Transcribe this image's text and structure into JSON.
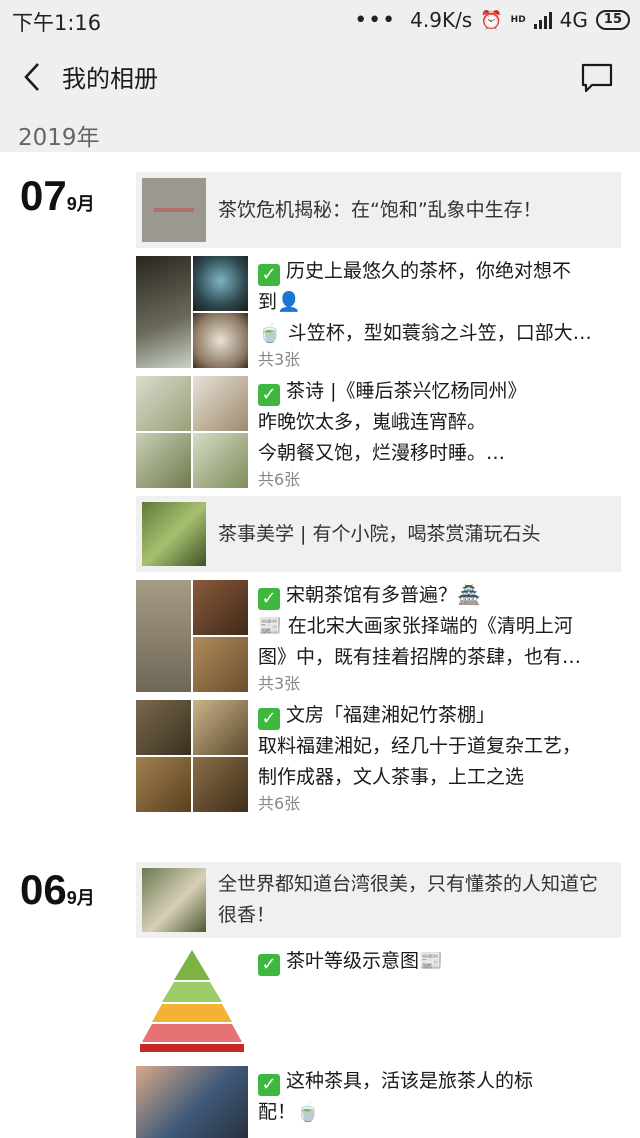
{
  "status": {
    "time": "下午1:16",
    "dots": "•••",
    "speed": "4.9K/s",
    "alarm": "⏰",
    "hd": "HD",
    "network": "4G",
    "battery": "15",
    "icons": [
      "alarm-icon",
      "signal-icon",
      "battery-icon"
    ]
  },
  "nav": {
    "title": "我的相册",
    "back_icon": "back-arrow-icon",
    "comment_icon": "comment-icon"
  },
  "year": "2019年",
  "groups": [
    {
      "day": "07",
      "month": "9月",
      "share1": {
        "text": "茶饮危机揭秘：在“饱和”乱象中生存！"
      },
      "posts": [
        {
          "lines": [
            "历史上最悠久的茶杯，你绝对想不",
            "到👤",
            "🍵 斗笠杯，型如蓑翁之斗笠，口部大…"
          ],
          "count": "共3张"
        },
        {
          "lines": [
            "茶诗 |《睡后茶兴忆杨同州》",
            "昨晚饮太多，嵬峨连宵醉。",
            "今朝餐又饱，烂漫移时睡。…"
          ],
          "count": "共6张"
        }
      ],
      "share2": {
        "text": "茶事美学 | 有个小院，喝茶赏蒲玩石头"
      },
      "posts2": [
        {
          "lines": [
            "宋朝茶馆有多普遍？🏯",
            "📰 在北宋大画家张择端的《清明上河",
            "图》中，既有挂着招牌的茶肆，也有…"
          ],
          "count": "共3张"
        },
        {
          "lines": [
            "文房「福建湘妃竹茶棚」",
            "取料福建湘妃，经几十于道复杂工艺，",
            "制作成器，文人茶事，上工之选"
          ],
          "count": "共6张"
        }
      ]
    },
    {
      "day": "06",
      "month": "9月",
      "share1": {
        "text": "全世界都知道台湾很美，只有懂茶的人知道它很香！"
      },
      "posts": [
        {
          "lines": [
            "茶叶等级示意图📰"
          ]
        },
        {
          "lines": [
            "这种茶具，活该是旅茶人的标",
            "配！🍵"
          ]
        }
      ]
    }
  ],
  "colors": {
    "bar_bg": "#efefef",
    "share_bg": "#f0f0f0",
    "check_green": "#3db73d",
    "count_gray": "#888888"
  }
}
